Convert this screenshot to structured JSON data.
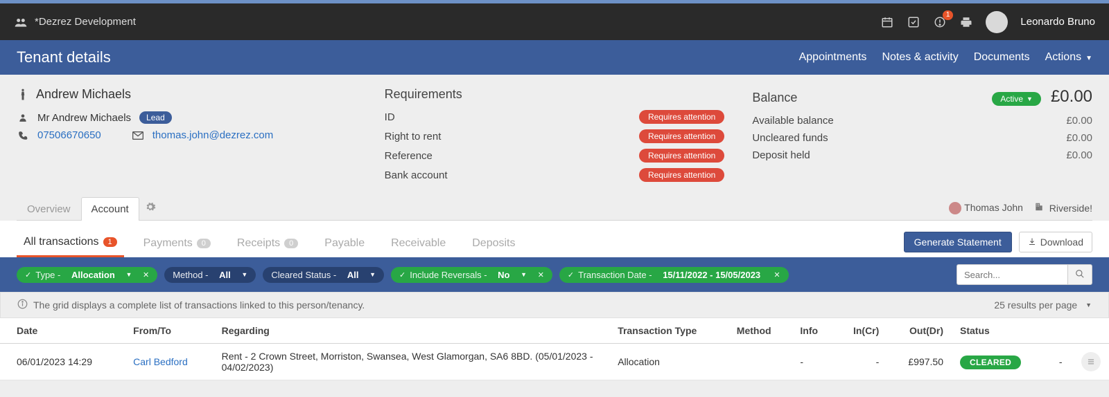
{
  "topbar": {
    "appTitle": "*Dezrez Development",
    "alertCount": "1",
    "userName": "Leonardo Bruno"
  },
  "pageHeader": {
    "title": "Tenant details",
    "nav": {
      "appointments": "Appointments",
      "notes": "Notes & activity",
      "documents": "Documents",
      "actions": "Actions"
    }
  },
  "tenant": {
    "name": "Andrew Michaels",
    "fullName": "Mr Andrew Michaels",
    "leadBadge": "Lead",
    "phone": "07506670650",
    "email": "thomas.john@dezrez.com"
  },
  "requirements": {
    "title": "Requirements",
    "items": [
      {
        "label": "ID",
        "status": "Requires attention"
      },
      {
        "label": "Right to rent",
        "status": "Requires attention"
      },
      {
        "label": "Reference",
        "status": "Requires attention"
      },
      {
        "label": "Bank account",
        "status": "Requires attention"
      }
    ]
  },
  "balance": {
    "title": "Balance",
    "statusLabel": "Active",
    "total": "£0.00",
    "rows": [
      {
        "label": "Available balance",
        "amount": "£0.00"
      },
      {
        "label": "Uncleared funds",
        "amount": "£0.00"
      },
      {
        "label": "Deposit held",
        "amount": "£0.00"
      }
    ]
  },
  "tabs": {
    "overview": "Overview",
    "account": "Account"
  },
  "tabFooter": {
    "person": "Thomas John",
    "branch": "Riverside!"
  },
  "subtabs": {
    "all": {
      "label": "All transactions",
      "count": "1"
    },
    "payments": {
      "label": "Payments",
      "count": "0"
    },
    "receipts": {
      "label": "Receipts",
      "count": "0"
    },
    "payable": {
      "label": "Payable"
    },
    "receivable": {
      "label": "Receivable"
    },
    "deposits": {
      "label": "Deposits"
    }
  },
  "buttons": {
    "generateStatement": "Generate Statement",
    "download": "Download"
  },
  "filters": {
    "type": {
      "label": "Type -",
      "value": "Allocation"
    },
    "method": {
      "label": "Method -",
      "value": "All"
    },
    "cleared": {
      "label": "Cleared Status -",
      "value": "All"
    },
    "reversals": {
      "label": "Include Reversals -",
      "value": "No"
    },
    "date": {
      "label": "Transaction Date -",
      "value": "15/11/2022 - 15/05/2023"
    },
    "searchPlaceholder": "Search..."
  },
  "infoStrip": {
    "text": "The grid displays a complete list of transactions linked to this person/tenancy.",
    "resultsText": "25 results per page"
  },
  "table": {
    "headers": {
      "date": "Date",
      "fromTo": "From/To",
      "regarding": "Regarding",
      "txnType": "Transaction Type",
      "method": "Method",
      "info": "Info",
      "inCr": "In(Cr)",
      "outDr": "Out(Dr)",
      "status": "Status"
    },
    "rows": [
      {
        "date": "06/01/2023 14:29",
        "fromTo": "Carl Bedford",
        "regarding": "Rent - 2 Crown Street, Morriston, Swansea, West Glamorgan, SA6 8BD. (05/01/2023 - 04/02/2023)",
        "txnType": "Allocation",
        "method": "",
        "info": "-",
        "inCr": "-",
        "outDr": "£997.50",
        "status": "CLEARED",
        "extra": "-"
      }
    ]
  }
}
